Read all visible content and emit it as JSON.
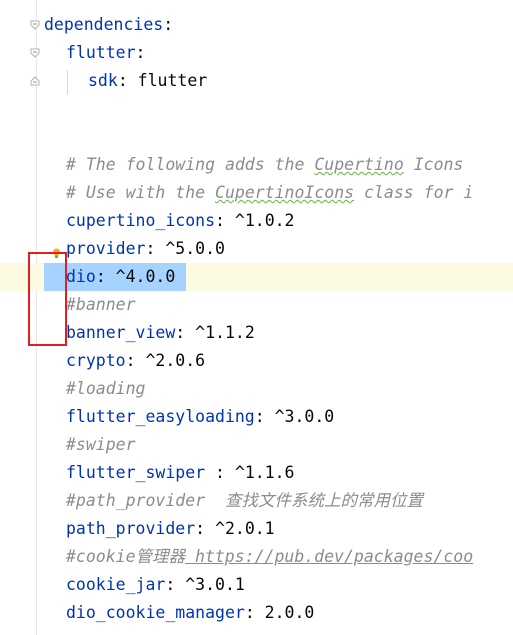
{
  "editor": {
    "lines": [
      {
        "key": "dependencies",
        "colon": ":"
      },
      {
        "key": "flutter",
        "colon": ":"
      },
      {
        "key": "sdk",
        "colon": ":",
        "value": " flutter"
      },
      {
        "comment_prefix": "# The following adds the ",
        "comment_wavy": "Cupertino",
        "comment_suffix": " Icons"
      },
      {
        "comment_prefix": "# Use with the ",
        "comment_wavy": "CupertinoIcons",
        "comment_suffix": " class for i"
      },
      {
        "key": "cupertino_icons",
        "colon": ":",
        "value": " ^1.0.2"
      },
      {
        "key": "provider",
        "colon": ":",
        "value": " ^5.0.0"
      },
      {
        "key": "dio",
        "colon": ":",
        "value": " ^4.0.0"
      },
      {
        "comment": "#banner"
      },
      {
        "key": "banner_view",
        "colon": ":",
        "value": " ^1.1.2"
      },
      {
        "key": "crypto",
        "colon": ":",
        "value": " ^2.0.6"
      },
      {
        "comment": "#loading"
      },
      {
        "key": "flutter_easyloading",
        "colon": ":",
        "value": " ^3.0.0"
      },
      {
        "comment": "#swiper"
      },
      {
        "key": "flutter_swiper",
        "colon": " :",
        "value": " ^1.1.6"
      },
      {
        "comment_prefix": "#path_provider  ",
        "comment_cjk": "查找文件系统上的常用位置"
      },
      {
        "key": "path_provider",
        "colon": ":",
        "value": " ^2.0.1"
      },
      {
        "comment_prefix": "#cookie",
        "comment_cjk": "管理器",
        "comment_url": " https://pub.dev/packages/coo"
      },
      {
        "key": "cookie_jar",
        "colon": ":",
        "value": " ^3.0.1"
      },
      {
        "key": "dio_cookie_manager",
        "colon": ":",
        "value": " 2.0.0"
      }
    ]
  },
  "colors": {
    "key": "#0033b3",
    "comment": "#8c8c8c",
    "selection": "#a6d2ff",
    "current_line": "#fcfae1",
    "annotation_box": "#e02020"
  },
  "icons": {
    "fold_open": "fold-open-icon",
    "fold_close": "fold-close-icon",
    "intention": "intention-bulb-icon"
  }
}
